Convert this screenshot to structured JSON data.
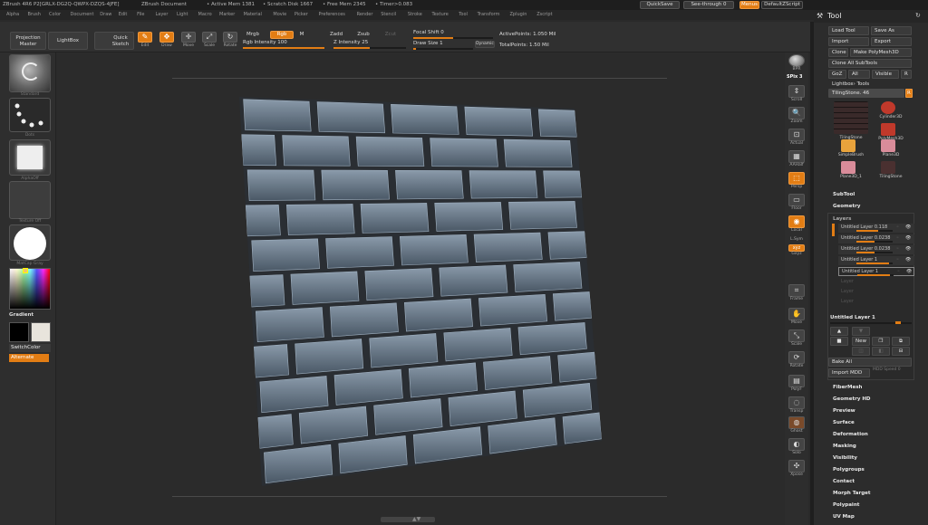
{
  "titlebar": {
    "app": "ZBrush 4R6 P2[GRLX-DG2Q-QWPX-DZQS-4JFE]",
    "document": "ZBrush Document",
    "active_mem": "• Active Mem 1381",
    "scratch": "• Scratch Disk 1667",
    "free_mem": "• Free Mem 2345",
    "timer": "• Timer>0.083"
  },
  "topright": {
    "quicksave": "QuickSave",
    "seethrough": "See-through",
    "seethrough_value": "0",
    "menus": "Menus",
    "default_script": "DefaultZScript"
  },
  "menubar": [
    "Alpha",
    "Brush",
    "Color",
    "Document",
    "Draw",
    "Edit",
    "File",
    "Layer",
    "Light",
    "Macro",
    "Marker",
    "Material",
    "Movie",
    "Picker",
    "Preferences",
    "Render",
    "Stencil",
    "Stroke",
    "Texture",
    "Tool",
    "Transform",
    "Zplugin",
    "Zscript"
  ],
  "toolshelf": {
    "projection_master": "Projection Master",
    "lightbox": "LightBox",
    "quick_sketch": "Quick Sketch",
    "edit": "Edit",
    "draw": "Draw",
    "move": "Move",
    "scale": "Scale",
    "rotate": "Rotate",
    "mrgb": "Mrgb",
    "rgb": "Rgb",
    "m": "M",
    "rgb_intensity": "Rgb Intensity 100",
    "zadd": "Zadd",
    "zsub": "Zsub",
    "zcut": "Zcut",
    "z_intensity": "Z Intensity 25",
    "focal_shift": "Focal Shift 0",
    "draw_size": "Draw Size 1",
    "dynamic": "Dynamic",
    "active_points": "ActivePoints: 1.050 Mil",
    "total_points": "TotalPoints: 1.50 Mil"
  },
  "leftshelf": {
    "brush": "Standard",
    "stroke": "Dots",
    "alpha": "AlphaOff",
    "texture": "Texture Off",
    "material": "MatCap Gray",
    "gradient": "Gradient",
    "switchcolor": "SwitchColor",
    "alternate": "Alternate"
  },
  "rightshelf": {
    "bpr": "BPR",
    "spix": "SPix 3",
    "scroll": "Scroll",
    "zoom": "Zoom",
    "actual": "Actual",
    "aahalf": "AAHalf",
    "persp": "Persp",
    "floor": "Floor",
    "local": "Local",
    "lsym": "L.Sym",
    "xyz": "Gxyz",
    "frame": "Frame",
    "move": "Move",
    "scale": "Scale",
    "rotate": "Rotate",
    "polyf": "PolyF",
    "transp": "Transp",
    "ghost": "Ghost",
    "solo": "Solo",
    "xpose": "Xpose"
  },
  "panel": {
    "title": "Tool",
    "load_tool": "Load Tool",
    "save_as": "Save As",
    "import": "Import",
    "export": "Export",
    "clone": "Clone",
    "make_polymesh": "Make PolyMesh3D",
    "clone_all": "Clone All SubTools",
    "goz": "GoZ",
    "all": "All",
    "visible": "Visible",
    "r": "R",
    "lightbox_tools": "Lightbox› Tools",
    "current_tool": "TilingStone. 46",
    "tools": [
      {
        "name": "TilingStone",
        "color": "#3a2a2a"
      },
      {
        "name": "Cylinder3D",
        "color": "#c0392b"
      },
      {
        "name": "PolyMesh3D",
        "color": "#c0392b"
      },
      {
        "name": "SimpleBrush",
        "color": "#e8a33c"
      },
      {
        "name": "Plane3D",
        "color": "#d98c9a"
      },
      {
        "name": "Plane3D_1",
        "color": "#d98c9a"
      },
      {
        "name": "TilingStone",
        "color": "#4a3030"
      }
    ],
    "subtool": "SubTool",
    "geometry": "Geometry",
    "layers": "Layers",
    "layer_rows": [
      {
        "name": "Untitled Layer 0.118",
        "level": 0.6
      },
      {
        "name": "Untitled Layer 0.0238",
        "level": 0.5
      },
      {
        "name": "Untitled Layer 0.0238",
        "level": 0.5
      },
      {
        "name": "Untitled Layer 1",
        "level": 0.9
      },
      {
        "name": "Untitled Layer 1",
        "level": 0.9
      }
    ],
    "empty_layers": [
      "Layer",
      "Layer",
      "Layer"
    ],
    "untitled_layer": "Untitled Layer 1",
    "new": "New",
    "bake_all": "Bake All",
    "import_mdd": "Import MDD",
    "mdd_speed": "MDD Speed 0",
    "sections": [
      "FiberMesh",
      "Geometry HD",
      "Preview",
      "Surface",
      "Deformation",
      "Masking",
      "Visibility",
      "Polygroups",
      "Contact",
      "Morph Target",
      "Polypaint",
      "UV Map"
    ]
  },
  "colors": {
    "accent": "#e27d14",
    "panel_bg": "#2c2c2c",
    "brick": "#5a6a7a",
    "mortar": "#2a2e33"
  }
}
